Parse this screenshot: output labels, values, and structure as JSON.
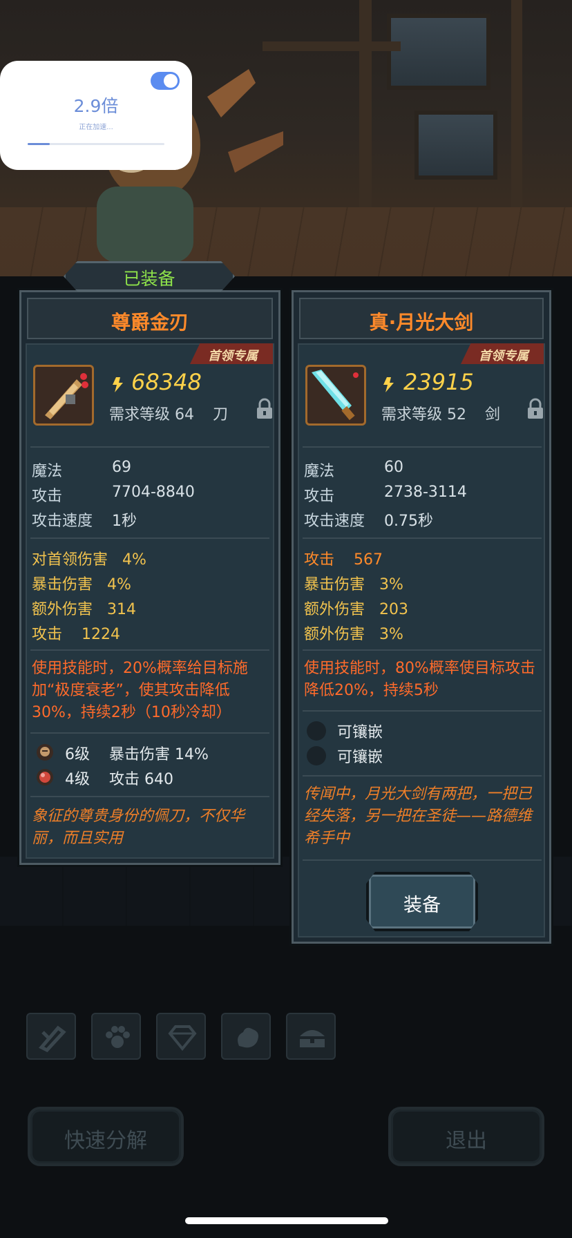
{
  "speed_overlay": {
    "multiplier": "2.9倍",
    "status": "正在加速...",
    "toggle_on": true,
    "progress": 0.16
  },
  "equipped_tab": {
    "label": "已装备"
  },
  "left_card": {
    "name": "尊爵金刃",
    "badge": "首领专属",
    "icon": "golden-blade-icon",
    "power": "68348",
    "requirement": "需求等级 64",
    "weapon_type": "刀",
    "stats": [
      {
        "label": "魔法",
        "value": "69"
      },
      {
        "label": "攻击",
        "value": "7704-8840"
      },
      {
        "label": "攻击速度",
        "value": "1秒"
      }
    ],
    "bonuses": [
      "对首领伤害   4%",
      "暴击伤害   4%",
      "额外伤害   314",
      "攻击    1224"
    ],
    "skill": "使用技能时，20%概率给目标施加“极度衰老”，使其攻击降低30%，持续2秒（10秒冷却）",
    "gems": [
      {
        "icon": "gem-face-icon",
        "text": "6级    暴击伤害 14%"
      },
      {
        "icon": "gem-red-icon",
        "text": "4级    攻击 640"
      }
    ],
    "lore": "象征的尊贵身份的佩刀，不仅华丽，而且实用"
  },
  "right_card": {
    "name": "真·月光大剑",
    "badge": "首领专属",
    "icon": "moonlight-sword-icon",
    "power": "23915",
    "requirement": "需求等级 52",
    "weapon_type": "剑",
    "stats": [
      {
        "label": "魔法",
        "value": "60"
      },
      {
        "label": "攻击",
        "value": "2738-3114"
      },
      {
        "label": "攻击速度",
        "value": "0.75秒"
      }
    ],
    "bonuses": [
      "攻击    567",
      "暴击伤害   3%",
      "额外伤害   203",
      "额外伤害   3%"
    ],
    "skill": "使用技能时，80%概率使目标攻击降低20%，持续5秒",
    "sockets": [
      "可镶嵌",
      "可镶嵌"
    ],
    "lore": "传闻中，月光大剑有两把，一把已经失落，另一把在圣徒——路德维希手中",
    "equip_button": "装备"
  },
  "bottom_tabs": [
    "weapon-tab-icon",
    "paw-tab-icon",
    "gem-tab-icon",
    "material-tab-icon",
    "chest-tab-icon"
  ],
  "bottom_buttons": {
    "decompose": "快速分解",
    "exit": "退出"
  },
  "colors": {
    "accent_orange": "#ff8a2a",
    "power_yellow": "#ffd24a",
    "bonus_gold": "#f2c34e",
    "skill_red": "#ff6b2b",
    "equipped_green": "#8ee24a"
  }
}
